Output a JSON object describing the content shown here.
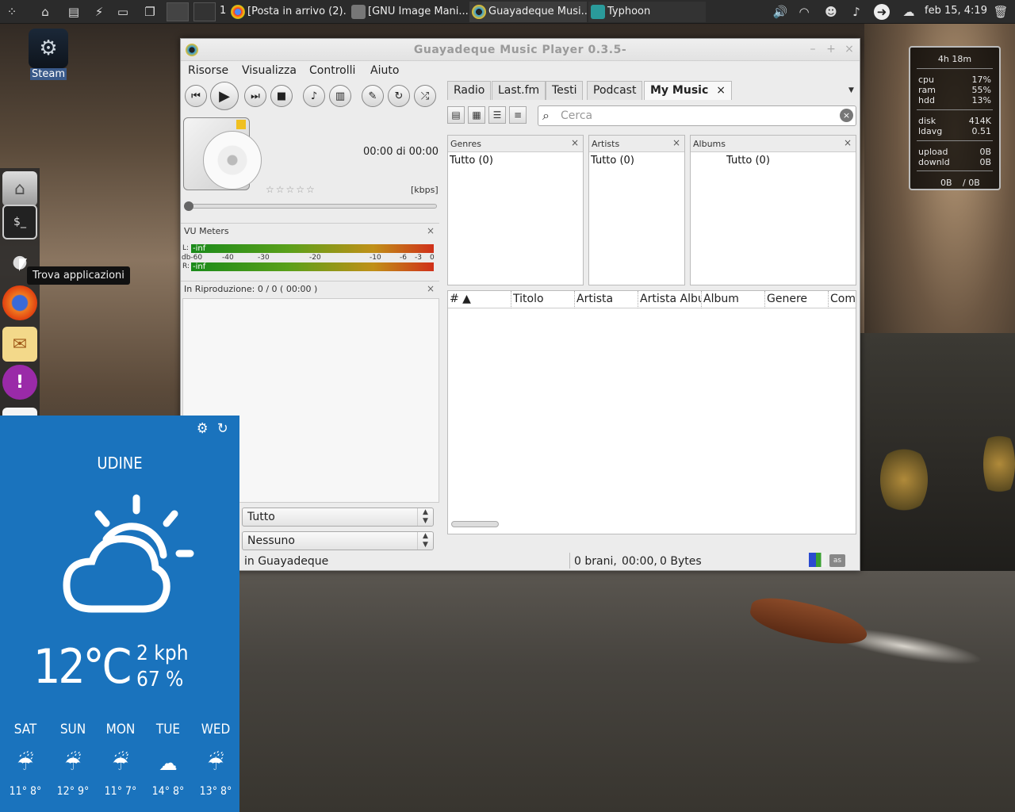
{
  "desktop": {
    "steam_label": "Steam",
    "tooltip": "Trova applicazioni"
  },
  "top_panel": {
    "workspace_number": "1",
    "tasks": [
      {
        "label": "[Posta in arrivo (2)...",
        "icon": "chrome-icon"
      },
      {
        "label": "[GNU Image Mani...",
        "icon": "gimp-icon"
      },
      {
        "label": "Guayadeque Musi...",
        "icon": "guayadeque-icon"
      },
      {
        "label": "Typhoon",
        "icon": "typhoon-icon"
      }
    ],
    "clock": "feb 15, 4:19"
  },
  "conky": {
    "uptime": "4h 18m",
    "cpu_label": "cpu",
    "cpu": "17%",
    "ram_label": "ram",
    "ram": "55%",
    "hdd_label": "hdd",
    "hdd": "13%",
    "disk_label": "disk",
    "disk": "414K",
    "ldavg_label": "ldavg",
    "ldavg": "0.51",
    "upload_label": "upload",
    "upload": "0B",
    "download_label": "downld",
    "download": "0B",
    "total_up": "0B",
    "total_down": "/ 0B"
  },
  "player": {
    "title": "Guayadeque Music Player 0.3.5-",
    "menu": [
      "Risorse",
      "Visualizza",
      "Controlli",
      "Aiuto"
    ],
    "time": "00:00 di 00:00",
    "kbps": "[kbps]",
    "vu_title": "VU Meters",
    "vu_l": "L:",
    "vu_r": "R:",
    "vu_l_value": "-inf",
    "vu_r_value": "-inf",
    "vu_db": "db-60",
    "vu_scale": [
      "-40",
      "-30",
      "-20",
      "-10",
      "-6",
      "-3",
      "0"
    ],
    "now_playing": "In Riproduzione:  0 / 0    ( 00:00 )",
    "combo1": "Tutto",
    "combo2": "Nessuno",
    "status_left": "in Guayadeque",
    "tabs": [
      "Radio",
      "Last.fm",
      "Testi",
      "Podcast",
      "My Music"
    ],
    "search_placeholder": "Cerca",
    "genres": {
      "title": "Genres",
      "item": "Tutto (0)"
    },
    "artists": {
      "title": "Artists",
      "item": "Tutto (0)"
    },
    "albums": {
      "title": "Albums",
      "item": "Tutto (0)"
    },
    "columns": [
      "# ▲",
      "Titolo",
      "Artista",
      "Artista Album",
      "Album",
      "Genere",
      "Compositore"
    ],
    "status_songs": "0 brani,",
    "status_time": "00:00,",
    "status_size": "0 Bytes",
    "lastfm_badge": "as"
  },
  "weather": {
    "city": "UDINE",
    "temp": "12°C",
    "wind": "2 kph",
    "humidity": "67 %",
    "forecast": [
      {
        "day": "SAT",
        "temps": "11° 8°",
        "icon": "rain-icon"
      },
      {
        "day": "SUN",
        "temps": "12° 9°",
        "icon": "rain-icon"
      },
      {
        "day": "MON",
        "temps": "11° 7°",
        "icon": "rain-icon"
      },
      {
        "day": "TUE",
        "temps": "14° 8°",
        "icon": "cloud-icon"
      },
      {
        "day": "WED",
        "temps": "13° 8°",
        "icon": "rain-icon"
      }
    ]
  }
}
